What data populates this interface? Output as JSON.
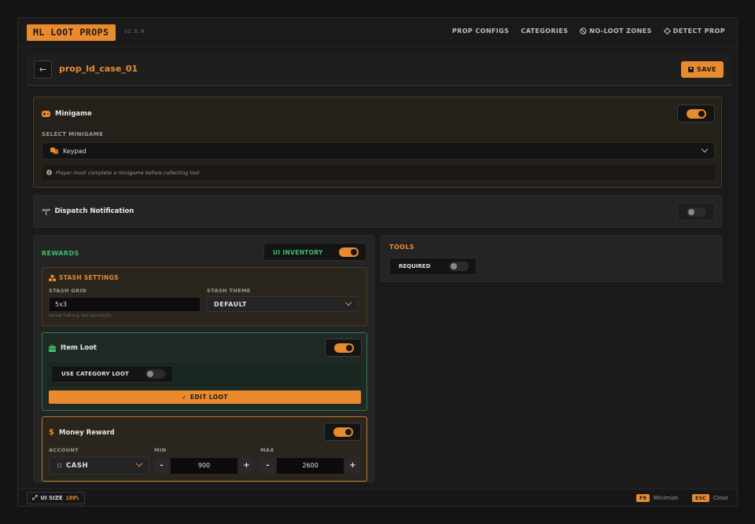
{
  "app": {
    "title": "ML LOOT PROPS",
    "version": "v1.0.0"
  },
  "nav": {
    "prop_configs": "PROP CONFIGS",
    "categories": "CATEGORIES",
    "no_loot_zones": "NO-LOOT ZONES",
    "detect_prop": "DETECT PROP",
    "no_loot_icon": "ban-icon",
    "detect_icon": "crosshair-icon"
  },
  "header": {
    "back_icon": "arrow-left-icon",
    "prop_id": "prop_ld_case_01",
    "save_label": "SAVE",
    "save_icon": "floppy-disk-icon"
  },
  "minigame": {
    "title": "Minigame",
    "icon": "gamepad-icon",
    "enabled": true,
    "select_label": "SELECT MINIGAME",
    "selected": "Keypad",
    "selected_icon": "keypad-icon",
    "note": "Player must complete a minigame before collecting loot",
    "note_icon": "info-icon"
  },
  "dispatch": {
    "title": "Dispatch Notification",
    "icon": "antenna-icon",
    "enabled": false
  },
  "rewards": {
    "title": "REWARDS",
    "ui_inventory_label": "UI INVENTORY",
    "ui_inventory_enabled": true,
    "stash": {
      "title": "STASH SETTINGS",
      "icon": "boxes-icon",
      "grid_label": "STASH GRID",
      "grid_value": "5x3",
      "grid_hint": "Format: CxR (e.g. 5x4, max 15x15)",
      "theme_label": "STASH THEME",
      "theme_value": "DEFAULT"
    },
    "item_loot": {
      "title": "Item Loot",
      "icon": "briefcase-icon",
      "enabled": true,
      "use_category_label": "USE CATEGORY LOOT",
      "use_category_enabled": false,
      "edit_label": "EDIT LOOT",
      "edit_icon": "check-icon"
    },
    "money": {
      "title": "Money Reward",
      "icon": "dollar-icon",
      "enabled": true,
      "account_label": "ACCOUNT",
      "account_value": "CASH",
      "min_label": "MIN",
      "min_value": "900",
      "max_label": "MAX",
      "max_value": "2600",
      "minus": "-",
      "plus": "+"
    }
  },
  "tools": {
    "title": "TOOLS",
    "required_label": "REQUIRED",
    "required_enabled": false
  },
  "footer": {
    "ui_size_label": "UI SIZE",
    "ui_size_value": "100%",
    "f9": "F9",
    "minimize": "Minimize",
    "esc": "ESC",
    "close": "Close"
  },
  "colors": {
    "accent": "#ea8a2f",
    "green": "#3fbf6a",
    "background": "#1a1a1a"
  }
}
